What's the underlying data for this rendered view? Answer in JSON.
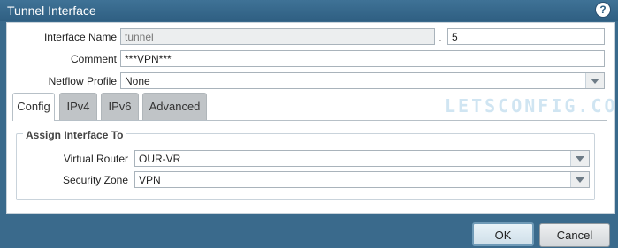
{
  "dialog": {
    "title": "Tunnel Interface",
    "help_icon": "question-mark-icon"
  },
  "form": {
    "interface_name_label": "Interface Name",
    "interface_name_value": "tunnel",
    "dot": ".",
    "interface_suffix_value": "5",
    "comment_label": "Comment",
    "comment_value": "***VPN***",
    "netflow_profile_label": "Netflow Profile",
    "netflow_profile_value": "None"
  },
  "tabs": [
    {
      "label": "Config",
      "active": true
    },
    {
      "label": "IPv4"
    },
    {
      "label": "IPv6"
    },
    {
      "label": "Advanced"
    }
  ],
  "config": {
    "section_title": "Assign Interface To",
    "virtual_router_label": "Virtual Router",
    "virtual_router_value": "OUR-VR",
    "security_zone_label": "Security Zone",
    "security_zone_value": "VPN"
  },
  "watermark": "LETSCONFIG.COM",
  "buttons": {
    "ok": "OK",
    "cancel": "Cancel"
  }
}
